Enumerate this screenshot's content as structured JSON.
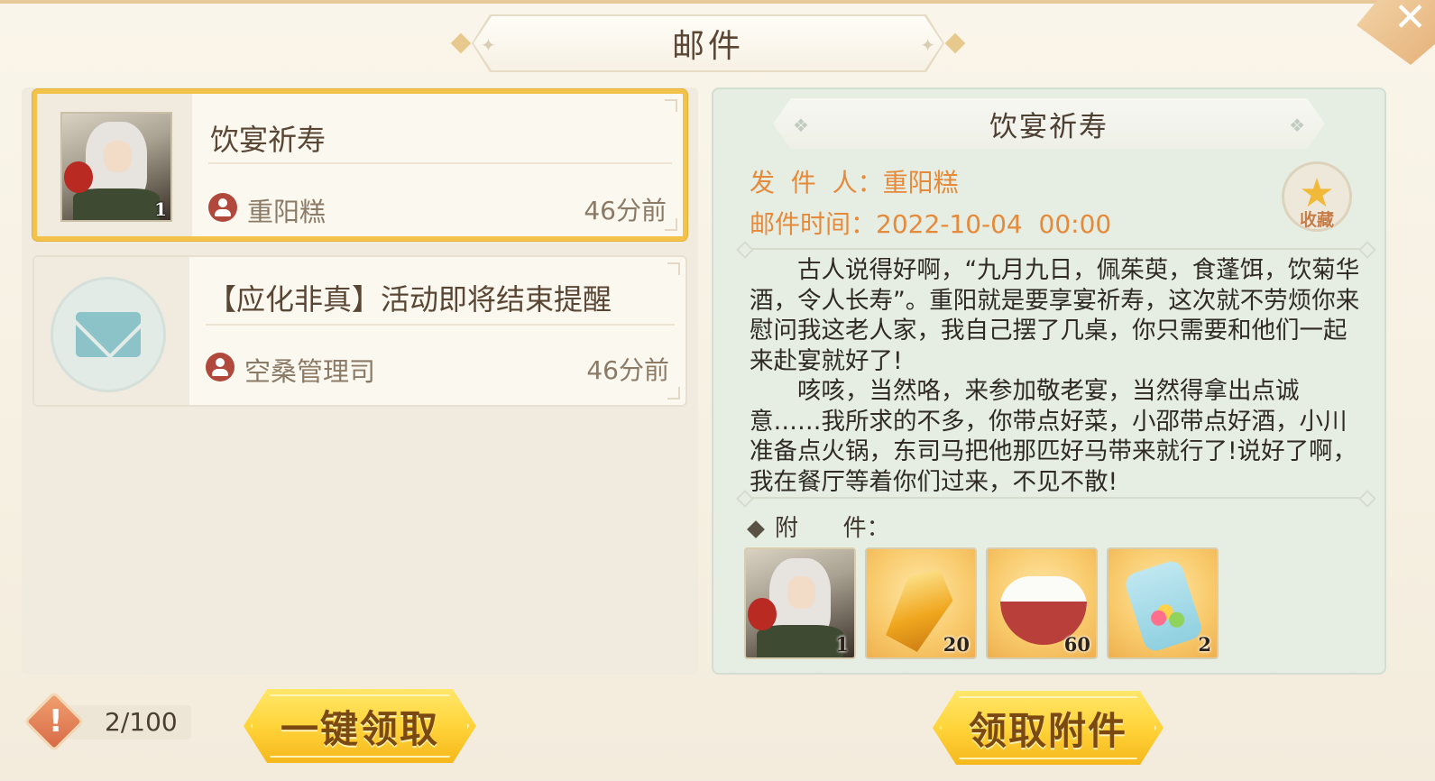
{
  "header": {
    "title": "邮件",
    "close_icon": "close-icon"
  },
  "mail_list": [
    {
      "title": "饮宴祈寿",
      "sender": "重阳糕",
      "time": "46分前",
      "thumb": "character-portrait",
      "thumb_count": "1",
      "selected": true
    },
    {
      "title": "【应化非真】活动即将结束提醒",
      "sender": "空桑管理司",
      "time": "46分前",
      "thumb": "envelope-icon",
      "selected": false
    }
  ],
  "detail": {
    "title": "饮宴祈寿",
    "sender_label": "发  件  人：",
    "sender": "重阳糕",
    "time_label": "邮件时间：",
    "time": "2022-10-04  00:00",
    "favorite_label": "收藏",
    "body": [
      "古人说得好啊，“九月九日，佩茱萸，食蓬饵，饮菊华酒，令人长寿”。重阳就是要享宴祈寿，这次就不劳烦你来慰问我这老人家，我自己摆了几桌，你只需要和他们一起来赴宴就好了!",
      "咳咳，当然咯，来参加敬老宴，当然得拿出点诚意……我所求的不多，你带点好菜，小邵带点好酒，小川准备点火锅，东司马把他那匹好马带来就行了!说好了啊，我在餐厅等着你们过来，不见不散!"
    ],
    "attachments_label": "附      件：",
    "attachments": [
      {
        "item": "character-portrait",
        "qty": "1"
      },
      {
        "item": "gold-crystal",
        "qty": "20"
      },
      {
        "item": "rice-bowl",
        "qty": "60"
      },
      {
        "item": "candy-jar",
        "qty": "2"
      }
    ]
  },
  "footer": {
    "mail_count": "2/100",
    "claim_all_label": "一键领取",
    "claim_attachments_label": "领取附件"
  },
  "colors": {
    "accent_gold": "#f2c24a",
    "meta_orange": "#e58a3a",
    "detail_bg": "#e6eee4"
  }
}
